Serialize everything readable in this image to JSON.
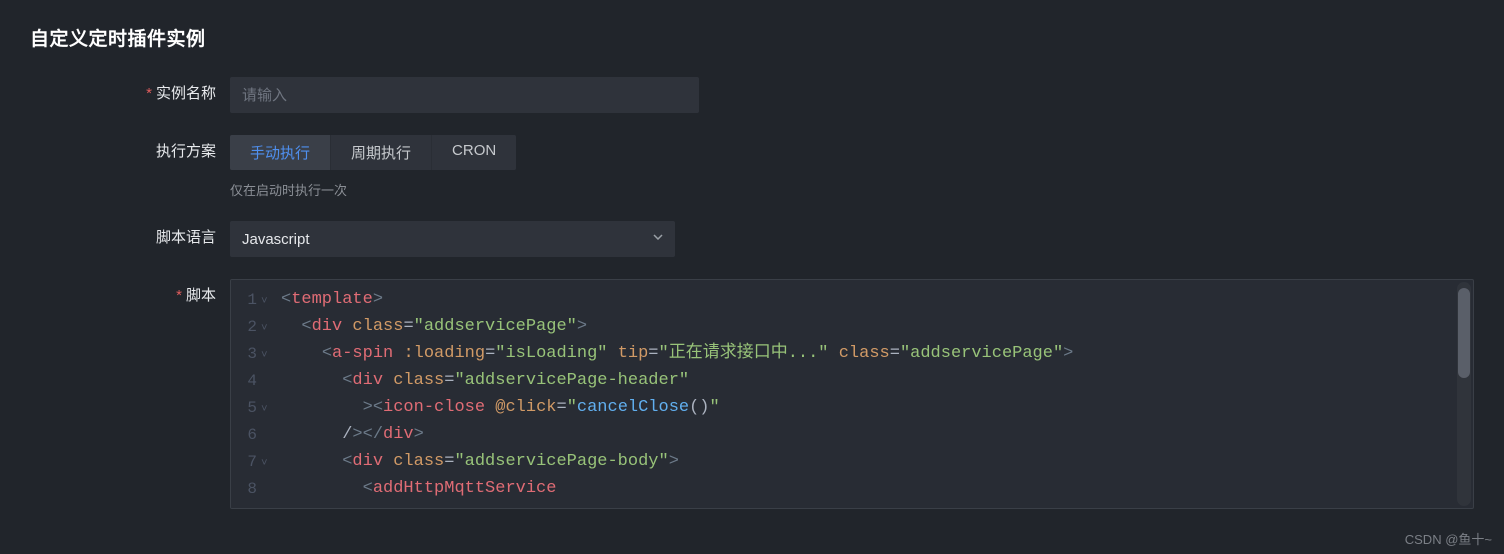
{
  "title": "自定义定时插件实例",
  "form": {
    "name": {
      "label": "实例名称",
      "required": true,
      "placeholder": "请输入",
      "value": ""
    },
    "schedule": {
      "label": "执行方案",
      "options": [
        "手动执行",
        "周期执行",
        "CRON"
      ],
      "active": "手动执行",
      "hint": "仅在启动时执行一次"
    },
    "language": {
      "label": "脚本语言",
      "value": "Javascript"
    },
    "script": {
      "label": "脚本",
      "required": true,
      "lines": [
        {
          "n": 1,
          "fold": true,
          "tokens": [
            [
              "ang",
              "<"
            ],
            [
              "tg",
              "template"
            ],
            [
              "ang",
              ">"
            ]
          ]
        },
        {
          "n": 2,
          "fold": true,
          "tokens": [
            [
              "pad",
              "  "
            ],
            [
              "ang",
              "<"
            ],
            [
              "tg",
              "div"
            ],
            [
              "plain",
              " "
            ],
            [
              "at",
              "class"
            ],
            [
              "op",
              "="
            ],
            [
              "s",
              "\"addservicePage\""
            ],
            [
              "ang",
              ">"
            ]
          ]
        },
        {
          "n": 3,
          "fold": true,
          "tokens": [
            [
              "pad",
              "    "
            ],
            [
              "ang",
              "<"
            ],
            [
              "tg",
              "a-spin"
            ],
            [
              "plain",
              " "
            ],
            [
              "at",
              ":loading"
            ],
            [
              "op",
              "="
            ],
            [
              "s",
              "\"isLoading\""
            ],
            [
              "plain",
              " "
            ],
            [
              "at",
              "tip"
            ],
            [
              "op",
              "="
            ],
            [
              "s",
              "\"正在请求接口中...\""
            ],
            [
              "plain",
              " "
            ],
            [
              "at",
              "class"
            ],
            [
              "op",
              "="
            ],
            [
              "s",
              "\"addservicePage\""
            ],
            [
              "ang",
              ">"
            ]
          ]
        },
        {
          "n": 4,
          "fold": false,
          "tokens": [
            [
              "pad",
              "      "
            ],
            [
              "ang",
              "<"
            ],
            [
              "tg",
              "div"
            ],
            [
              "plain",
              " "
            ],
            [
              "at",
              "class"
            ],
            [
              "op",
              "="
            ],
            [
              "s",
              "\"addservicePage-header\""
            ]
          ]
        },
        {
          "n": 5,
          "fold": true,
          "tokens": [
            [
              "pad",
              "        "
            ],
            [
              "ang",
              ">"
            ],
            [
              "ang",
              "<"
            ],
            [
              "tg",
              "icon-close"
            ],
            [
              "plain",
              " "
            ],
            [
              "at",
              "@click"
            ],
            [
              "op",
              "="
            ],
            [
              "s",
              "\""
            ],
            [
              "fn",
              "cancelClose"
            ],
            [
              "plain",
              "()"
            ],
            [
              "s",
              "\""
            ]
          ]
        },
        {
          "n": 6,
          "fold": false,
          "tokens": [
            [
              "pad",
              "      "
            ],
            [
              "plain",
              "/"
            ],
            [
              "ang",
              ">"
            ],
            [
              "ang",
              "</"
            ],
            [
              "tg",
              "div"
            ],
            [
              "ang",
              ">"
            ]
          ]
        },
        {
          "n": 7,
          "fold": true,
          "tokens": [
            [
              "pad",
              "      "
            ],
            [
              "ang",
              "<"
            ],
            [
              "tg",
              "div"
            ],
            [
              "plain",
              " "
            ],
            [
              "at",
              "class"
            ],
            [
              "op",
              "="
            ],
            [
              "s",
              "\"addservicePage-body\""
            ],
            [
              "ang",
              ">"
            ]
          ]
        },
        {
          "n": 8,
          "fold": false,
          "tokens": [
            [
              "pad",
              "        "
            ],
            [
              "ang",
              "<"
            ],
            [
              "tg",
              "addHttpMqttService"
            ]
          ]
        }
      ]
    }
  },
  "watermark": "CSDN @鱼十~"
}
